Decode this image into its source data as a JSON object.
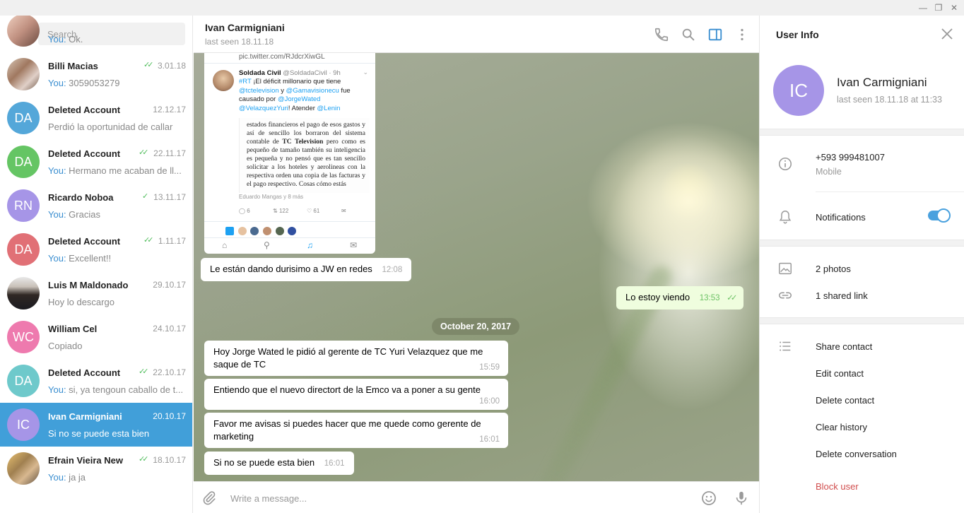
{
  "search": {
    "placeholder": "Search"
  },
  "dialogs": [
    {
      "name": "",
      "preview_you": "You:",
      "preview": " Ok.",
      "date": "",
      "check": "",
      "avatar": "",
      "color": "#d9b9a4",
      "photo": true
    },
    {
      "name": "Billi Macias",
      "preview_you": "You:",
      "preview": " 3059053279",
      "date": "3.01.18",
      "check": "✓✓",
      "avatar": "",
      "color": "#b09070",
      "photo": true
    },
    {
      "name": "Deleted Account",
      "preview_you": "",
      "preview": "Perdió la oportunidad de callar",
      "date": "12.12.17",
      "check": "",
      "avatar": "DA",
      "color": "#54a7d9"
    },
    {
      "name": "Deleted Account",
      "preview_you": "You:",
      "preview": " Hermano me acaban de ll...",
      "date": "22.11.17",
      "check": "✓✓",
      "avatar": "DA",
      "color": "#65c564"
    },
    {
      "name": "Ricardo Noboa",
      "preview_you": "You:",
      "preview": " Gracias",
      "date": "13.11.17",
      "check": "✓",
      "avatar": "RN",
      "color": "#a695e7"
    },
    {
      "name": "Deleted Account",
      "preview_you": "You:",
      "preview": " Excellent!!",
      "date": "1.11.17",
      "check": "✓✓",
      "avatar": "DA",
      "color": "#e17076"
    },
    {
      "name": "Luis M Maldonado",
      "preview_you": "",
      "preview": "Hoy lo descargo",
      "date": "29.10.17",
      "check": "",
      "avatar": "",
      "color": "#4a4038",
      "photo": true
    },
    {
      "name": "William Cel",
      "preview_you": "",
      "preview": "Copiado",
      "date": "24.10.17",
      "check": "",
      "avatar": "WC",
      "color": "#ee7aae"
    },
    {
      "name": "Deleted Account",
      "preview_you": "You:",
      "preview": " si, ya tengoun caballo de t...",
      "date": "22.10.17",
      "check": "✓✓",
      "avatar": "DA",
      "color": "#6ec9cb"
    },
    {
      "name": "Ivan Carmigniani",
      "preview_you": "",
      "preview": "Si no se puede esta bien",
      "date": "20.10.17",
      "check": "",
      "avatar": "IC",
      "color": "#a695e7",
      "active": true
    },
    {
      "name": "Efrain Vieira New",
      "preview_you": "You:",
      "preview": " ja ja",
      "date": "18.10.17",
      "check": "✓✓",
      "avatar": "",
      "color": "#a08a60",
      "photo": true
    }
  ],
  "chat": {
    "name": "Ivan Carmigniani",
    "status": "last seen 18.11.18",
    "composer_placeholder": "Write a message...",
    "date_separator": "October 20, 2017",
    "tweet": {
      "url": "pic.twitter.com/RJdcrXiwGL",
      "author": "Soldada Civil",
      "handle": "@SoldadaCivil · 9h",
      "hashtag": "#RT",
      "text1": " ¡El déficit millonario que tiene ",
      "m1": "@tctelevision",
      "text2": " y ",
      "m2": "@Gamavisionecu",
      "text3": " fue causado por ",
      "m3": "@JorgeWated",
      "m4": "@VelazquezYuri",
      "text4": "!  Atender ",
      "m5": "@Lenin",
      "image_text_a": "estados financieros el pago de esos gastos y así de sencillo los borraron del sistema contable de ",
      "image_text_bold": "TC Television",
      "image_text_b": " pero como es pequeño de tamaño también su inteligencia es pequeña y no pensó que es tan sencillo solicitar a los hoteles y aerolineas con la respectiva orden una copia de las facturas y el pago respectivo.  Cosas  cómo  estás",
      "image_caption": "Eduardo Mangas y 8 más",
      "replies": "6",
      "retweets": "122",
      "likes": "61"
    },
    "messages": [
      {
        "text": "Le están dando durisimo a JW en redes",
        "time": "12:08",
        "dir": "in"
      },
      {
        "text": "Lo estoy viendo",
        "time": "13:53",
        "dir": "out"
      },
      {
        "text": "Hoy Jorge Wated le pidió al gerente de TC Yuri Velazquez que me saque de TC",
        "time": "15:59",
        "dir": "in"
      },
      {
        "text": "Entiendo que el nuevo directort de la Emco va a poner a su gente",
        "time": "16:00",
        "dir": "in"
      },
      {
        "text": "Favor me avisas si puedes hacer que me quede como gerente de marketing",
        "time": "16:01",
        "dir": "in"
      },
      {
        "text": "Si no se puede esta bien",
        "time": "16:01",
        "dir": "in"
      }
    ]
  },
  "user_info": {
    "title": "User Info",
    "avatar": "IC",
    "name": "Ivan Carmigniani",
    "seen": "last seen 18.11.18 at 11:33",
    "phone": "+593 999481007",
    "phone_label": "Mobile",
    "notifications": "Notifications",
    "notifications_on": true,
    "photos": "2 photos",
    "links": "1 shared link",
    "actions": [
      "Share contact",
      "Edit contact",
      "Delete contact",
      "Clear history",
      "Delete conversation"
    ],
    "block": "Block user"
  },
  "colors": {
    "accent": "#419fd9",
    "outgoing": "#effdde",
    "check": "#4fbd5b",
    "danger": "#d14e4e"
  }
}
